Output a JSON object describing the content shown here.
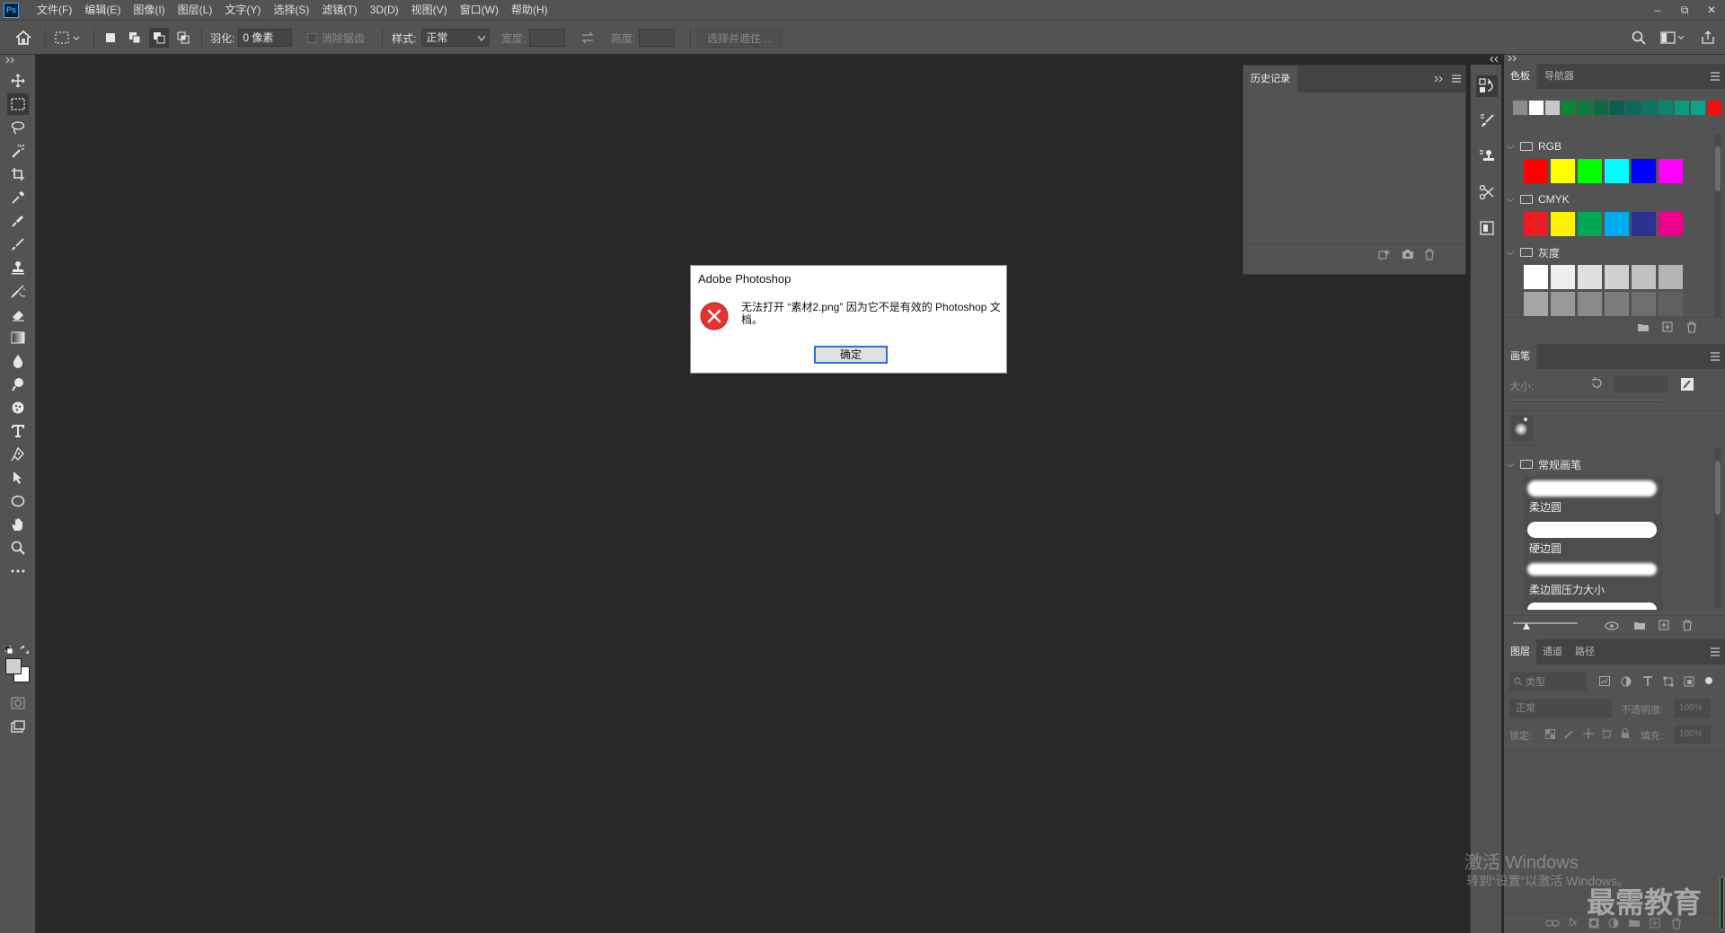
{
  "app": {
    "logo_text": "Ps",
    "menu": [
      "文件(F)",
      "编辑(E)",
      "图像(I)",
      "图层(L)",
      "文字(Y)",
      "选择(S)",
      "滤镜(T)",
      "3D(D)",
      "视图(V)",
      "窗口(W)",
      "帮助(H)"
    ],
    "window_controls": {
      "minimize": "–",
      "restore": "⧉",
      "close": "✕"
    }
  },
  "options_bar": {
    "feather_label": "羽化:",
    "feather_value": "0 像素",
    "antialias_label": "消除锯齿",
    "style_label": "样式:",
    "style_value": "正常",
    "width_label": "宽度:",
    "height_label": "高度:",
    "select_mask_label": "选择并遮住 ..."
  },
  "toolbar": {
    "tools": [
      "move",
      "marquee",
      "lasso",
      "magic-wand",
      "crop",
      "eyedropper",
      "healing-brush",
      "brush",
      "clone-stamp",
      "history-brush",
      "eraser",
      "gradient",
      "blur",
      "dodge",
      "pen",
      "type",
      "path-select",
      "shape",
      "hand",
      "zoom",
      "more"
    ],
    "active_tool": "marquee"
  },
  "history_panel": {
    "tab": "历史记录"
  },
  "swatches_panel": {
    "tabs": [
      "色板",
      "导航器"
    ],
    "recent": [
      "#8c8c8c",
      "#ffffff",
      "#c8c8c8",
      "#0a8a2e",
      "#0b7a3a",
      "#0b6a42",
      "#0a5f50",
      "#0a6a55",
      "#0b7762",
      "#0c856d",
      "#0a9a7a",
      "#11a08a",
      "#ee1111"
    ],
    "groups": [
      {
        "name": "RGB",
        "colors": [
          "#ff0000",
          "#ffff00",
          "#00ff00",
          "#00ffff",
          "#0000ff",
          "#ff00ff"
        ]
      },
      {
        "name": "CMYK",
        "colors": [
          "#ec1c24",
          "#fff200",
          "#00a651",
          "#00aeef",
          "#2e3192",
          "#ec008c"
        ]
      },
      {
        "name": "灰度",
        "colors": [
          "#ffffff",
          "#eeeeee",
          "#e0e0e0",
          "#d0d0d0",
          "#c2c2c2",
          "#b4b4b4",
          "#a6a6a6",
          "#989898",
          "#8a8a8a",
          "#7c7c7c",
          "#6e6e6e",
          "#606060"
        ]
      }
    ]
  },
  "brush_panel": {
    "tab": "画笔",
    "size_label": "大小:",
    "group_name": "常规画笔",
    "brushes": [
      "柔边圆",
      "硬边圆",
      "柔边圆压力大小"
    ]
  },
  "layers_panel": {
    "tabs": [
      "图层",
      "通道",
      "路径"
    ],
    "filter_placeholder": "类型",
    "blend_mode": "正常",
    "opacity_label": "不透明度:",
    "opacity_value": "100%",
    "lock_label": "锁定:",
    "fill_label": "填充:",
    "fill_value": "100%"
  },
  "dialog": {
    "title": "Adobe Photoshop",
    "message": "无法打开 “素材2.png” 因为它不是有效的 Photoshop 文档。",
    "ok_label": "确定"
  },
  "watermarks": {
    "activate_title": "激活 Windows",
    "activate_sub": "转到“设置”以激活 Windows。",
    "brand": "最需教育"
  }
}
